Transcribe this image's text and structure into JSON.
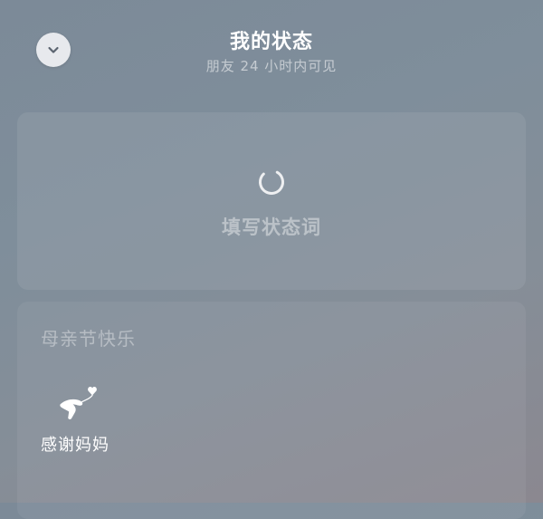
{
  "header": {
    "title": "我的状态",
    "subtitle": "朋友 24 小时内可见"
  },
  "status_input": {
    "placeholder": "填写状态词"
  },
  "category": {
    "title": "母亲节快乐",
    "options": [
      {
        "label": "感谢妈妈",
        "icon": "heart-balloon-hand-icon"
      }
    ]
  },
  "icons": {
    "collapse": "chevron-down-icon",
    "loading": "loading-spinner-icon"
  },
  "colors": {
    "button_bg": "#e7e9ed",
    "chevron": "#5b6470",
    "text_primary": "#ffffff"
  }
}
